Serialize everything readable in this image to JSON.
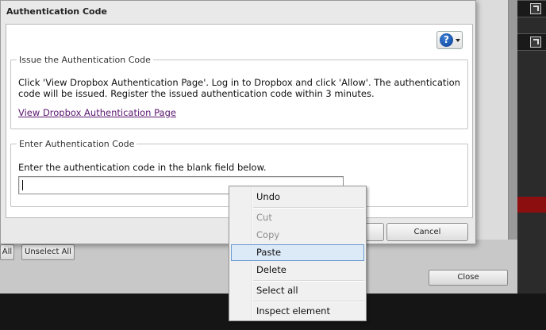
{
  "dialog": {
    "title": "Authentication Code",
    "help_icon_char": "?",
    "issue_group": {
      "legend": "Issue the Authentication Code",
      "instructions": "Click 'View Dropbox Authentication Page'. Log in to Dropbox and click 'Allow'. The authentication code will be issued. Register the issued authentication code within 3 minutes.",
      "link_text": "View Dropbox Authentication Page"
    },
    "enter_group": {
      "legend": "Enter Authentication Code",
      "instructions": "Enter the authentication code in the blank field below.",
      "input_value": ""
    },
    "buttons": {
      "cancel": "Cancel"
    }
  },
  "background": {
    "all_button": "All",
    "unselect_all_button": "Unselect All",
    "close_button": "Close"
  },
  "context_menu": {
    "items": [
      {
        "label": "Undo",
        "enabled": true
      },
      {
        "label": "Cut",
        "enabled": false
      },
      {
        "label": "Copy",
        "enabled": false
      },
      {
        "label": "Paste",
        "enabled": true,
        "highlighted": true
      },
      {
        "label": "Delete",
        "enabled": true
      },
      {
        "label": "Select all",
        "enabled": true
      },
      {
        "label": "Inspect element",
        "enabled": true
      }
    ]
  },
  "colors": {
    "link": "#5a1670",
    "menu_highlight": "#dce9f7",
    "menu_highlight_border": "#6b9ad2",
    "help_icon": "#0b3f94",
    "background_alert": "#8c0e0e"
  }
}
